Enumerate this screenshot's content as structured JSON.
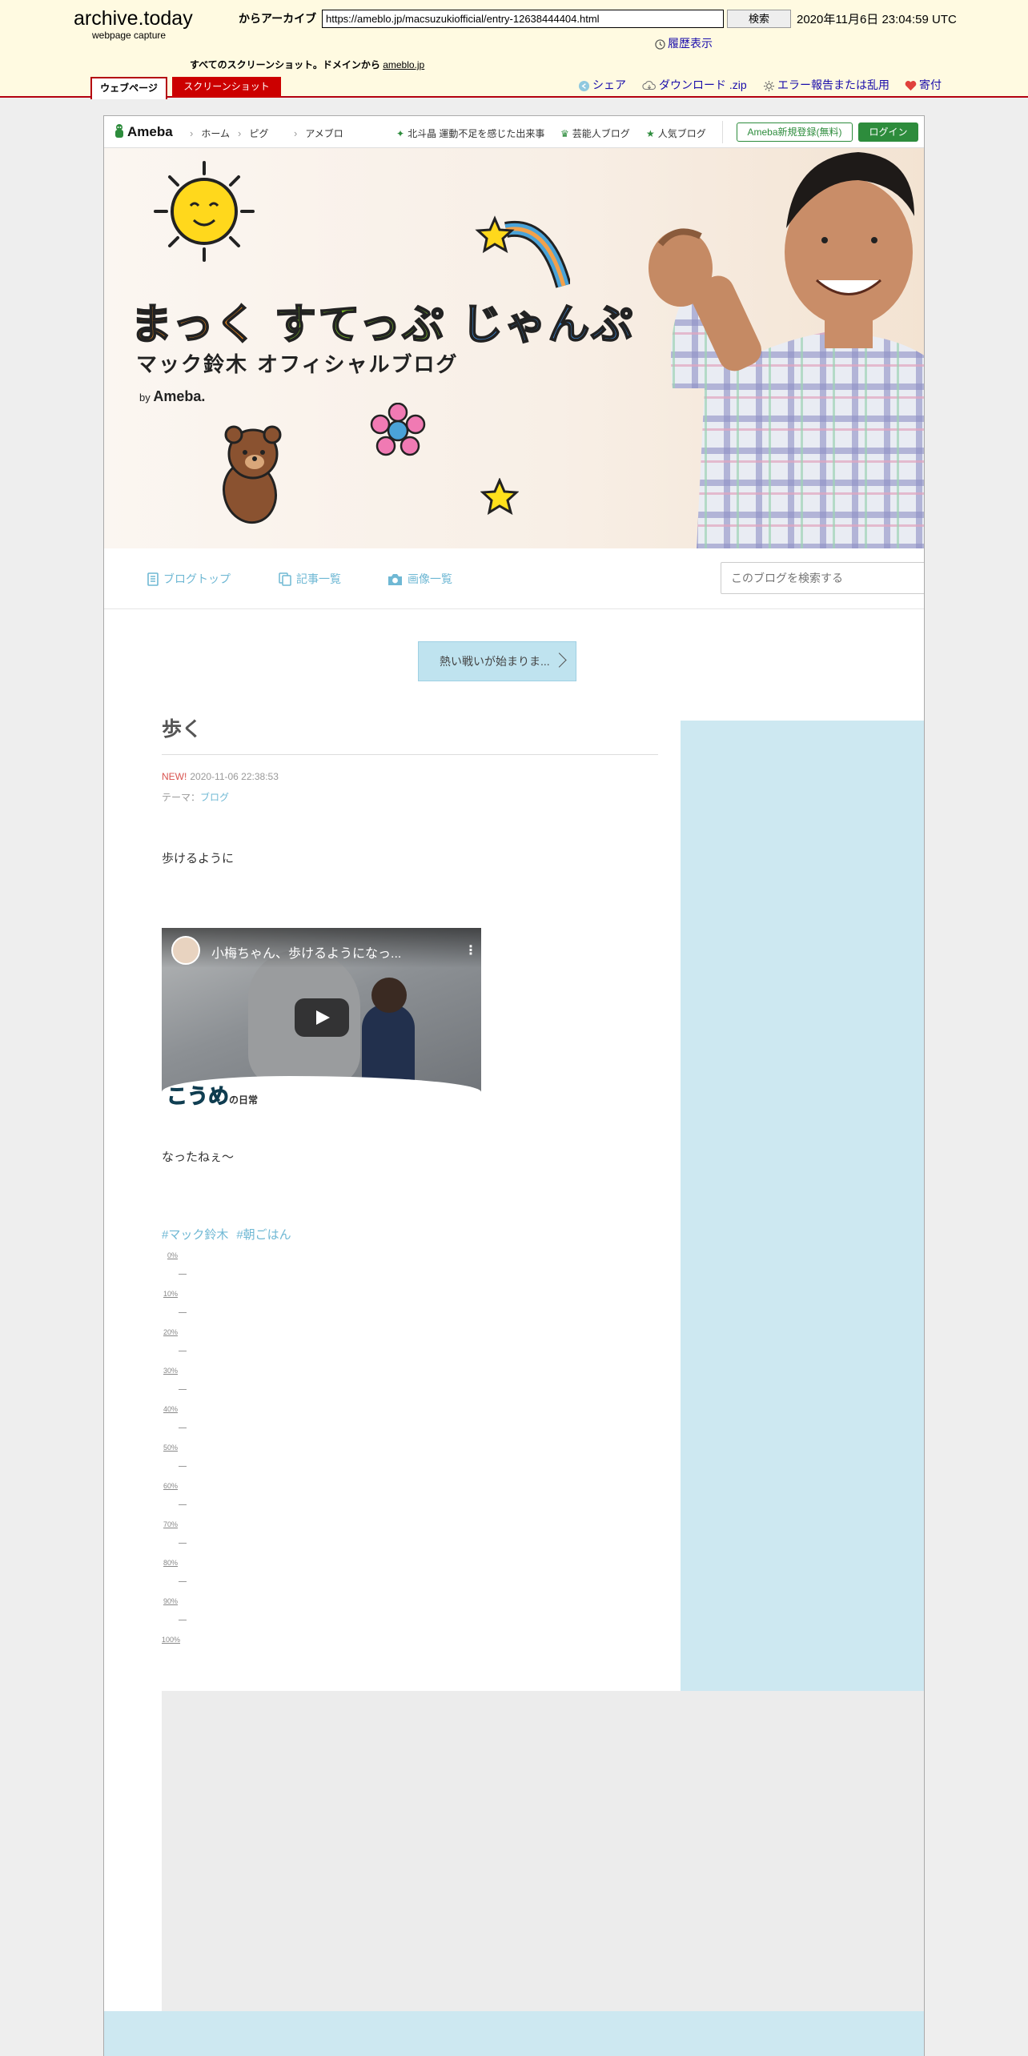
{
  "archive": {
    "logo": "archive.today",
    "logo_sub": "webpage capture",
    "from_label": "からアーカイブ",
    "url": "https://ameblo.jp/macsuzukiofficial/entry-12638444404.html",
    "search_label": "検索",
    "timestamp": "2020年11月6日 23:04:59 UTC",
    "history": "履歴表示",
    "all_shots_label": "すべてのスクリーンショット。ドメインから",
    "domain_link": "ameblo.jp",
    "tab_webpage": "ウェブページ",
    "tab_screenshot": "スクリーンショット",
    "share": "シェア",
    "download": "ダウンロード .zip",
    "report": "エラー報告または乱用",
    "donate": "寄付"
  },
  "nav": {
    "brand": "Ameba",
    "links": [
      "ホーム",
      "ピグ",
      "アメブロ"
    ],
    "trend": "北斗晶 運動不足を感じた出来事",
    "celeb": "芸能人ブログ",
    "popular": "人気ブログ",
    "register": "Ameba新規登録(無料)",
    "login": "ログイン"
  },
  "banner": {
    "title_1": "まっく",
    "title_2": "すてっぷ",
    "title_3": "じゃんぷ",
    "subtitle": "マック鈴木 オフィシャルブログ",
    "by_prefix": "by",
    "by_brand": "Ameba."
  },
  "blognav": {
    "top": "ブログトップ",
    "articles": "記事一覧",
    "images": "画像一覧",
    "search_placeholder": "このブログを検索する"
  },
  "promo": "熱い戦いが始まりま...",
  "post": {
    "title": "歩く",
    "new_label": "NEW!",
    "date": "2020-11-06 22:38:53",
    "theme_label": "テーマ：",
    "theme": "ブログ",
    "line1": "歩けるように",
    "line2": "なったねぇ〜",
    "video_title": "小梅ちゃん、歩けるようになっ...",
    "video_logo": "こうめ",
    "video_logo_small": "の日常",
    "tags": [
      "#マック鈴木",
      "#朝ごはん"
    ]
  },
  "ticks": [
    "0%",
    "10%",
    "20%",
    "30%",
    "40%",
    "50%",
    "60%",
    "70%",
    "80%",
    "90%",
    "100%"
  ],
  "colors": {
    "archive_bg": "#fffae1",
    "archive_accent": "#b40010",
    "ameba_green": "#2d8c3c",
    "blog_blue": "#6fb8d4",
    "side_blue": "#cde8f1"
  }
}
